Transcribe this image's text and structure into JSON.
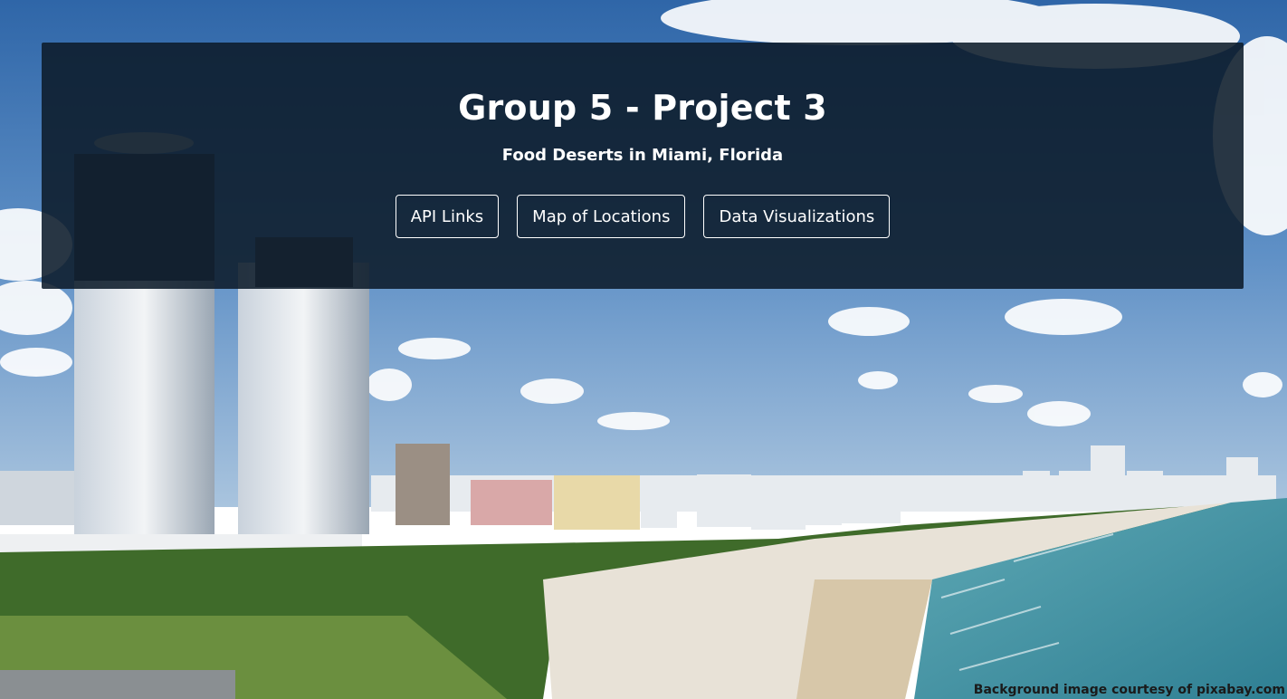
{
  "header": {
    "title": "Group 5 - Project 3",
    "subtitle": "Food Deserts in Miami, Florida"
  },
  "nav": {
    "buttons": [
      {
        "label": "API Links"
      },
      {
        "label": "Map of Locations"
      },
      {
        "label": "Data Visualizations"
      }
    ]
  },
  "footer": {
    "credit_text": "Background image courtesy of",
    "credit_link": "pixabay.com"
  },
  "colors": {
    "overlay": "#0d1b2a",
    "sky": "#4a7fb5",
    "ocean": "#4c9aa8",
    "sand": "#e6ddd0",
    "foliage": "#3f6b2a"
  }
}
